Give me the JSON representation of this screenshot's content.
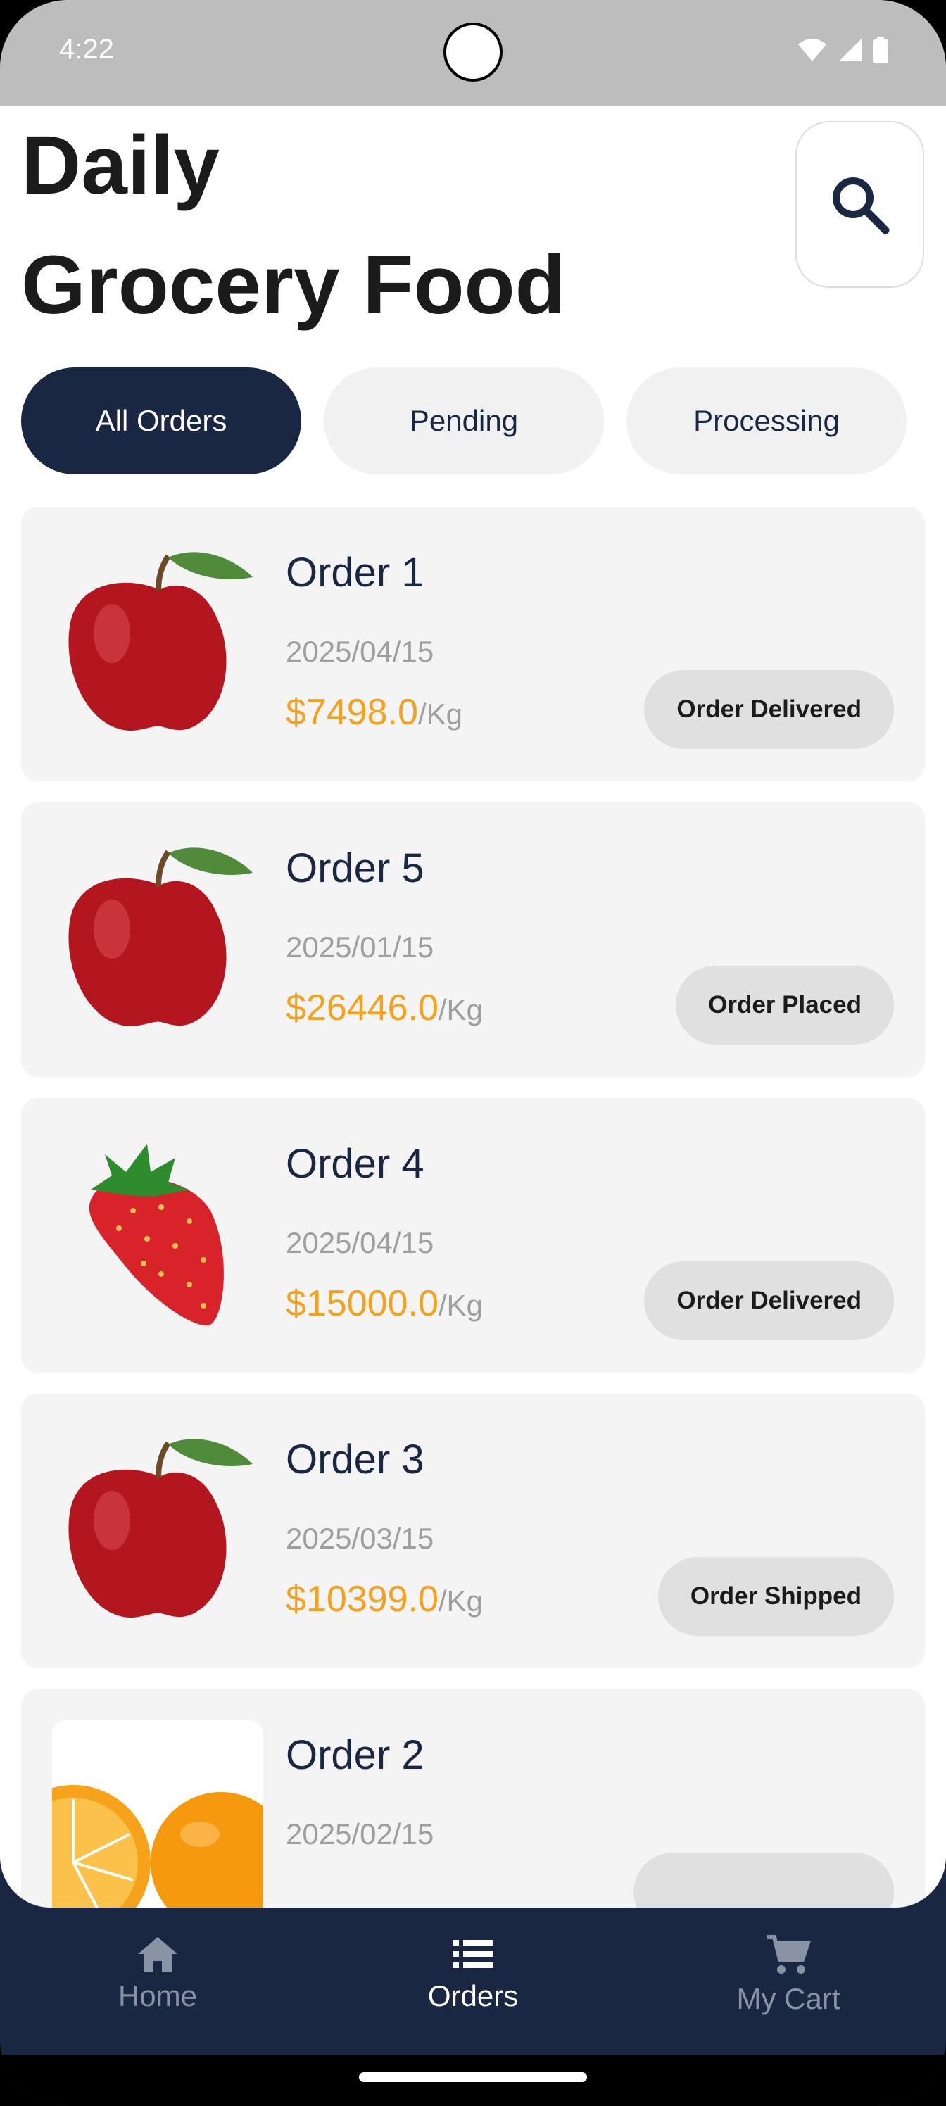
{
  "status_bar": {
    "time": "4:22"
  },
  "header": {
    "title_line1": "Daily",
    "title_line2": "Grocery Food"
  },
  "filters": [
    {
      "label": "All Orders",
      "active": true
    },
    {
      "label": "Pending",
      "active": false
    },
    {
      "label": "Processing",
      "active": false
    }
  ],
  "orders": [
    {
      "name": "Order 1",
      "date": "2025/04/15",
      "price": "$7498.0",
      "unit": "/Kg",
      "status": "Order Delivered",
      "image": "apple"
    },
    {
      "name": "Order 5",
      "date": "2025/01/15",
      "price": "$26446.0",
      "unit": "/Kg",
      "status": "Order Placed",
      "image": "apple"
    },
    {
      "name": "Order 4",
      "date": "2025/04/15",
      "price": "$15000.0",
      "unit": "/Kg",
      "status": "Order Delivered",
      "image": "strawberry"
    },
    {
      "name": "Order 3",
      "date": "2025/03/15",
      "price": "$10399.0",
      "unit": "/Kg",
      "status": "Order Shipped",
      "image": "apple"
    },
    {
      "name": "Order 2",
      "date": "2025/02/15",
      "price": "",
      "unit": "",
      "status": "",
      "image": "orange"
    }
  ],
  "nav": [
    {
      "label": "Home",
      "icon": "home-icon",
      "active": false
    },
    {
      "label": "Orders",
      "icon": "list-icon",
      "active": true
    },
    {
      "label": "My Cart",
      "icon": "cart-icon",
      "active": false
    }
  ],
  "colors": {
    "primary": "#1a2742",
    "price": "#f5a11c",
    "card": "#f4f4f4",
    "chip": "#f1f1f1"
  }
}
